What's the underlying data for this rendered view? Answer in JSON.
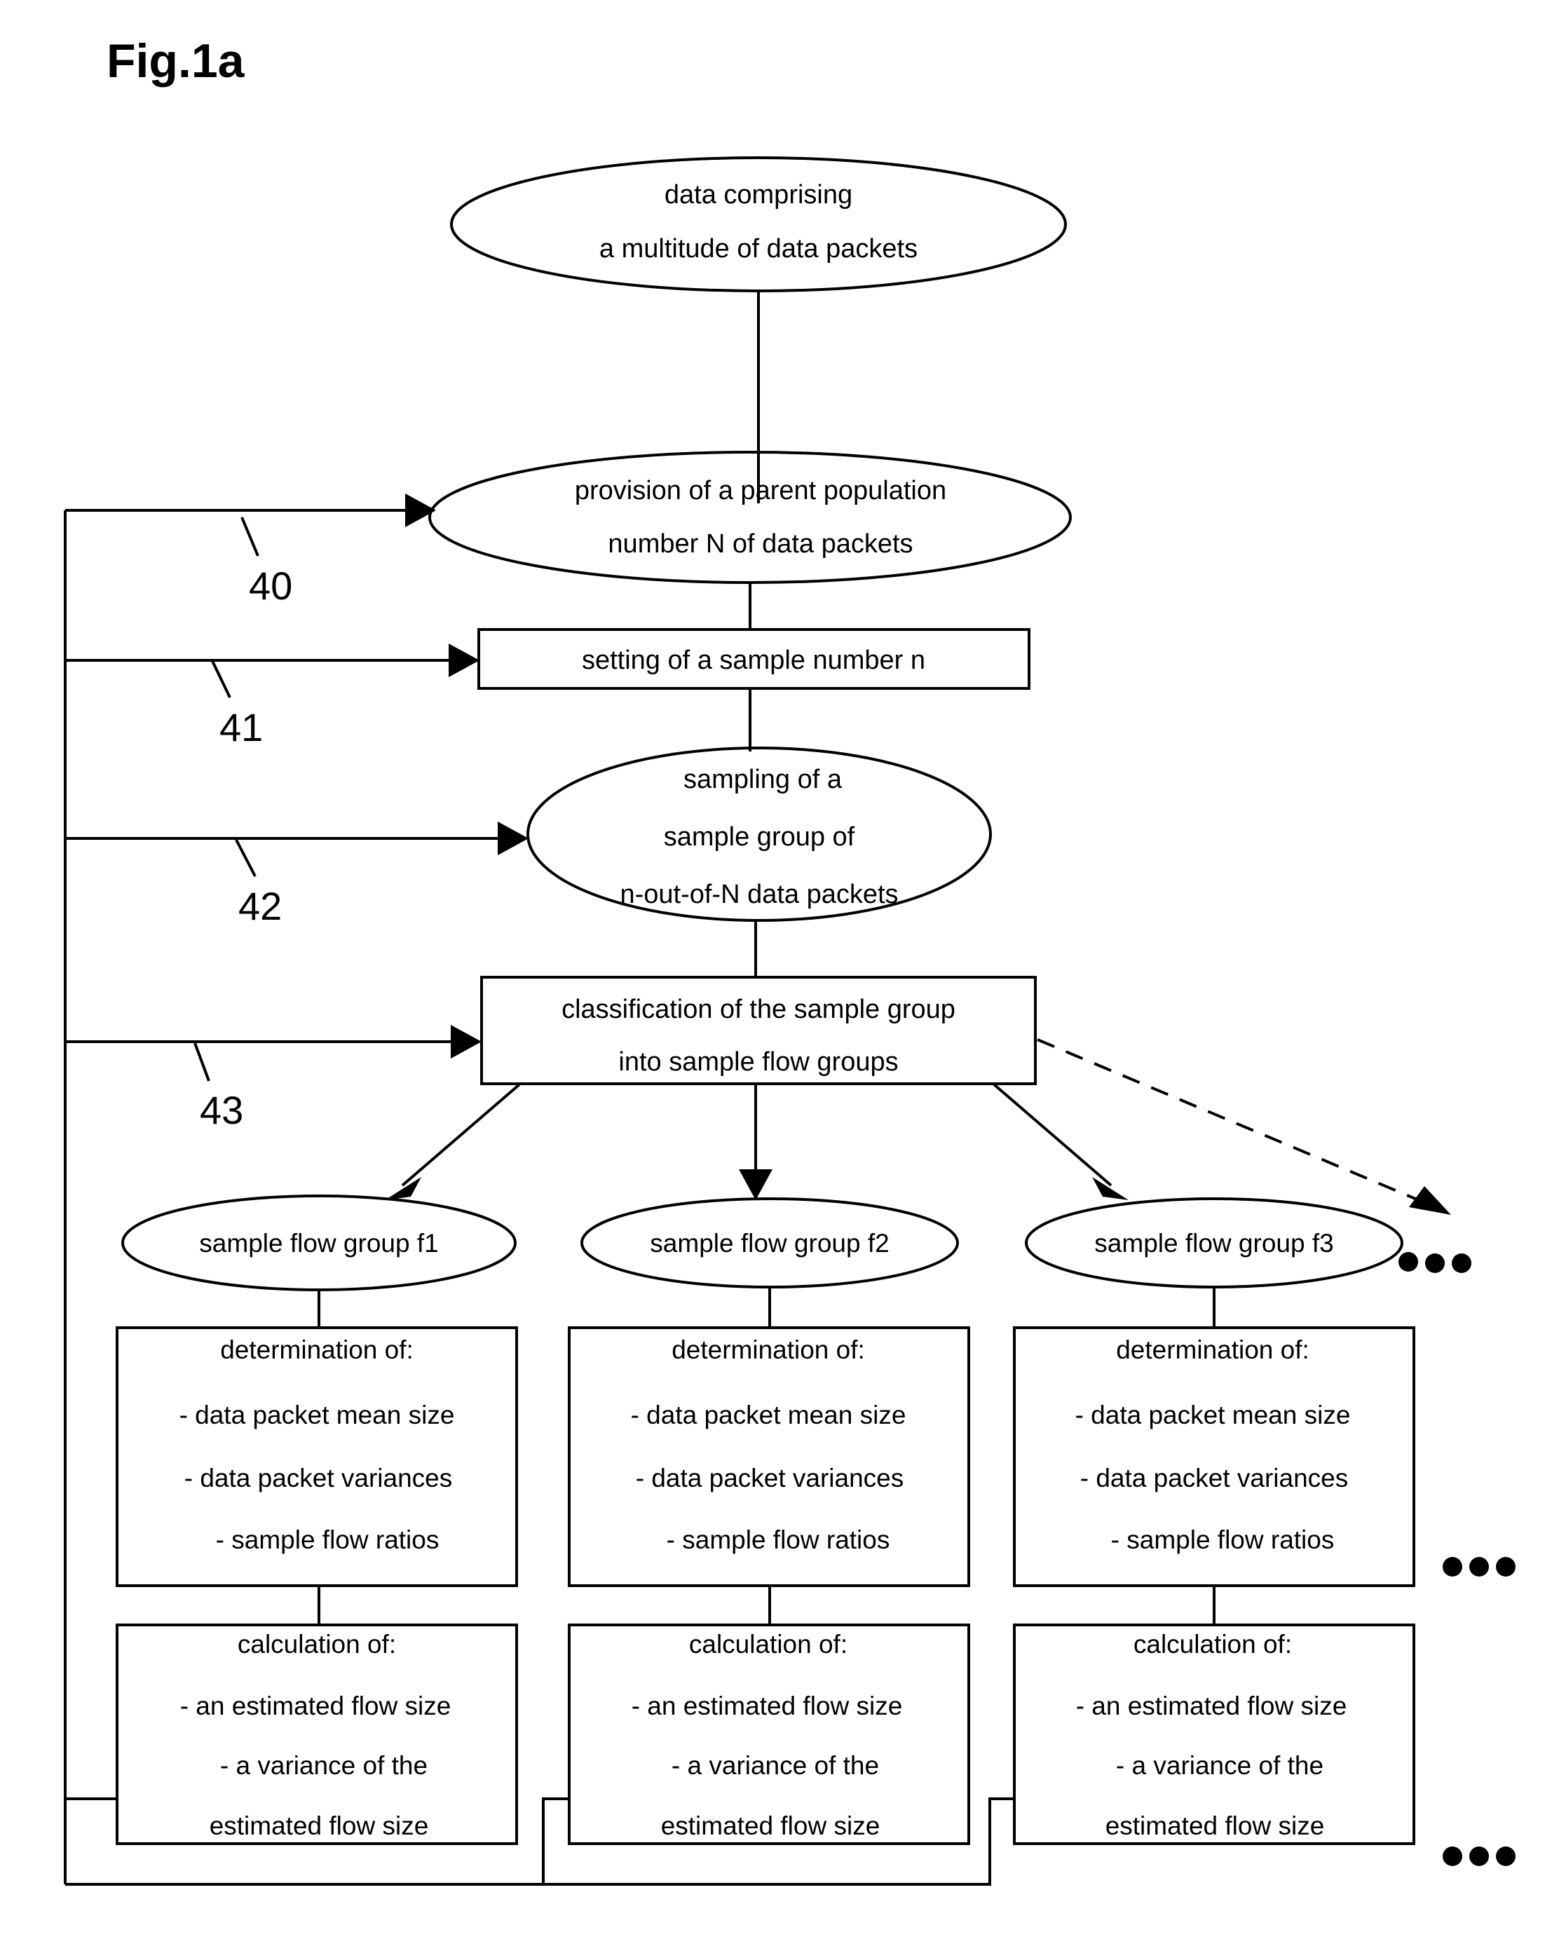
{
  "figure": {
    "title": "Fig.1a"
  },
  "nodes": {
    "source": {
      "shape": "ellipse",
      "lines": [
        "data comprising",
        "a multitude of data packets"
      ]
    },
    "provision": {
      "shape": "ellipse",
      "lines": [
        "provision of a parent population",
        "number N of data packets"
      ]
    },
    "setting": {
      "shape": "rect",
      "lines": [
        "setting of a sample number n"
      ]
    },
    "sampling": {
      "shape": "ellipse",
      "lines": [
        "sampling of a",
        "sample group of",
        "n-out-of-N data packets"
      ]
    },
    "classification": {
      "shape": "rect",
      "lines": [
        "classification of the sample group",
        "into sample flow groups"
      ]
    }
  },
  "reference_numbers": [
    {
      "label": "40"
    },
    {
      "label": "41"
    },
    {
      "label": "42"
    },
    {
      "label": "43"
    }
  ],
  "columns": [
    {
      "group": {
        "shape": "ellipse",
        "lines": [
          "sample flow group f1"
        ]
      },
      "determination": {
        "shape": "rect",
        "lines": [
          "determination of:",
          "- data packet mean size",
          "- data packet variances",
          "- sample flow ratios"
        ]
      },
      "calculation": {
        "shape": "rect",
        "lines": [
          "calculation of:",
          "- an estimated flow size",
          "- a variance of the",
          "estimated flow size"
        ]
      }
    },
    {
      "group": {
        "shape": "ellipse",
        "lines": [
          "sample flow group f2"
        ]
      },
      "determination": {
        "shape": "rect",
        "lines": [
          "determination of:",
          "- data packet mean size",
          "- data packet variances",
          "- sample flow ratios"
        ]
      },
      "calculation": {
        "shape": "rect",
        "lines": [
          "calculation of:",
          "- an estimated flow size",
          "- a variance of the",
          "estimated flow size"
        ]
      }
    },
    {
      "group": {
        "shape": "ellipse",
        "lines": [
          "sample flow group f3"
        ]
      },
      "determination": {
        "shape": "rect",
        "lines": [
          "determination of:",
          "- data packet mean size",
          "- data packet variances",
          "- sample flow ratios"
        ]
      },
      "calculation": {
        "shape": "rect",
        "lines": [
          "calculation of:",
          "- an estimated flow size",
          "- a variance of the",
          "estimated flow size"
        ]
      }
    }
  ],
  "ellipsis": [
    {
      "label": "…",
      "after": "sample flow group f3"
    },
    {
      "label": "…",
      "after": "determination of f3"
    },
    {
      "label": "…",
      "after": "calculation of f3"
    }
  ],
  "colors": {
    "stroke": "#000000",
    "background": "#ffffff",
    "text": "#000000"
  }
}
